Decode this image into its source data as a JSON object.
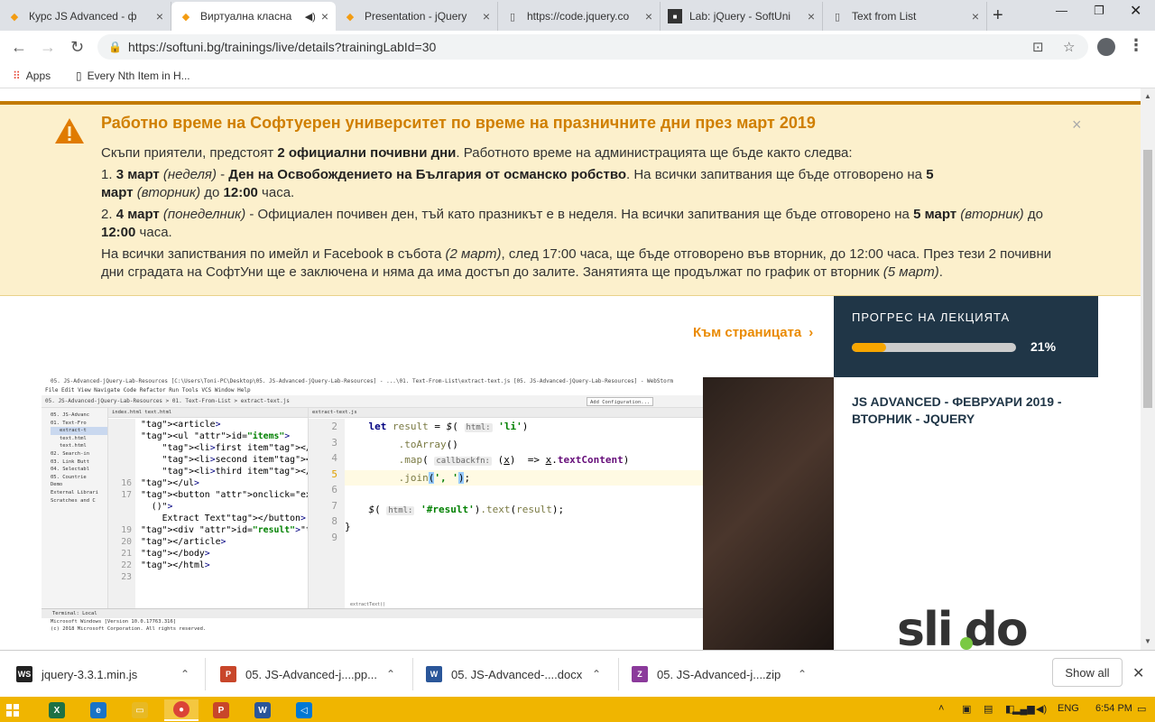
{
  "tabs": [
    {
      "title": "Курс JS Advanced - ф",
      "favicon": "softuni-icon",
      "active": false
    },
    {
      "title": "Виртуална класна",
      "favicon": "softuni-icon",
      "active": true
    },
    {
      "title": "Presentation - jQuery",
      "favicon": "softuni-icon",
      "active": false
    },
    {
      "title": "https://code.jquery.co",
      "favicon": "document-icon",
      "active": false
    },
    {
      "title": "Lab: jQuery - SoftUni",
      "favicon": "judge-icon",
      "active": false
    },
    {
      "title": "Text from List",
      "favicon": "document-icon",
      "active": false
    }
  ],
  "address": {
    "url": "https://softuni.bg/trainings/live/details?trainingLabId=30"
  },
  "bookmarks": [
    {
      "label": "Apps",
      "icon": "apps-grid-icon"
    },
    {
      "label": "Every Nth Item in H...",
      "icon": "document-icon"
    }
  ],
  "alert": {
    "title": "Работно време на Софтуерен университет по време на празничните дни през март 2019",
    "intro_a": "Скъпи приятели, предстоят ",
    "intro_b": "2 официални почивни дни",
    "intro_c": ". Работното време на администрацията ще бъде както следва:",
    "item1_num": "1. ",
    "item1_date": "3 март",
    "item1_day": " (неделя)",
    "item1_dash": " - ",
    "item1_name": "Ден на Освобождението на България от османско робство",
    "item1_text": ". На всички запитвания ще бъде отговорено на ",
    "item1_reply": "5 март",
    "item1_reply_day": " (вторник)",
    "item1_until": " до ",
    "item1_time": "12:00",
    "item1_end": " часа.",
    "item2_num": "2. ",
    "item2_date": "4 март",
    "item2_day": " (понеделник)",
    "item2_text": " - Официален почивен ден, тъй като празникът е в неделя. На всички запитвания ще бъде отговорено на ",
    "item2_reply": "5 март",
    "item2_reply_day": " (вторник)",
    "item2_until": " до ",
    "item2_time": "12:00",
    "item2_end": " часа.",
    "footer_a": "На всички запиствания по имейл и Facebook в събота ",
    "footer_sat": "(2 март)",
    "footer_b": ", след 17:00 часа, ще бъде отговорено във вторник, до 12:00 часа. През тези 2 почивни дни сградата на СофтУни ще е заключена и няма да има достъп до залите. Занятията ще продължат по график от вторник ",
    "footer_tue": "(5 март)",
    "footer_end": "."
  },
  "to_page": {
    "label": "Към страницата"
  },
  "progress": {
    "label": "ПРОГРЕС НА ЛЕКЦИЯТА",
    "percent_text": "21%",
    "value": 0.21
  },
  "course": {
    "title": "JS ADVANCED - ФЕВРУАРИ 2019 - ВТОРНИК - JQUERY"
  },
  "video": {
    "ide_title": "05. JS-Advanced-jQuery-Lab-Resources [C:\\Users\\Toni-PC\\Desktop\\05. JS-Advanced-jQuery-Lab-Resources] - ...\\01. Text-From-List\\extract-text.js [05. JS-Advanced-jQuery-Lab-Resources] - WebStorm",
    "ide_menu": "File  Edit  View  Navigate  Code  Refactor  Run  Tools  VCS  Window  Help",
    "ide_nav": "05. JS-Advanced-jQuery-Lab-Resources  >  01. Text-From-List  >  extract-text.js",
    "add_config": "Add Configuration...",
    "tree": [
      "05. JS-Advanc",
      "01. Text-Fro",
      "extract-t",
      "text.html",
      "text.html",
      "02. Search-in",
      "03. Link Butt",
      "04. Selectabl",
      "05. Countrie",
      "Demo",
      "External Librari",
      "Scratches and C"
    ],
    "left_tab": "index.html   text.html",
    "left_lines": [
      "16",
      "17",
      "18",
      "19",
      "20",
      "21",
      "22",
      "23",
      "",
      "",
      "",
      "",
      "",
      ""
    ],
    "left_code": [
      "<article>",
      "<ul id=\"items\">",
      "    <li>first item</li>",
      "    <li>second item</li>",
      "    <li>third item</li>",
      "</ul>",
      "<button onclick=\"extractText",
      "  ()\">",
      "    Extract Text</button>",
      "<div id=\"result\"></div>",
      "</article>",
      "</body>",
      "</html>",
      ""
    ],
    "right_tab": "extract-text.js",
    "status": "extractText()",
    "terminal_header": "Terminal:   Local",
    "terminal_lines": [
      "Microsoft Windows [Version 10.0.17763.316]",
      "(c) 2018 Microsoft Corporation. All rights reserved."
    ]
  },
  "slido": {
    "text": "sli do"
  },
  "downloads": [
    {
      "name": "jquery-3.3.1.min.js",
      "icon": "webstorm-icon",
      "color": "#222"
    },
    {
      "name": "05. JS-Advanced-j....pp...",
      "icon": "powerpoint-icon",
      "color": "#c8462a"
    },
    {
      "name": "05. JS-Advanced-....docx",
      "icon": "word-icon",
      "color": "#2a5699"
    },
    {
      "name": "05. JS-Advanced-j....zip",
      "icon": "archive-icon",
      "color": "#8b3a9b"
    }
  ],
  "show_all": "Show all",
  "taskbar": {
    "lang": "ENG",
    "time": "6:54 PM"
  }
}
